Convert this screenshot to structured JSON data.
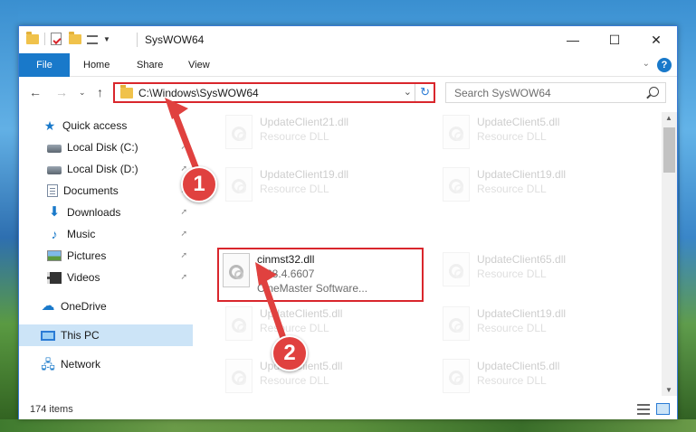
{
  "window": {
    "title": "SysWOW64",
    "controls": {
      "minimize": "—",
      "maximize": "☐",
      "close": "✕"
    }
  },
  "ribbon": {
    "tabs": [
      "File",
      "Home",
      "Share",
      "View"
    ],
    "expand_glyph": "⌄",
    "help_glyph": "?"
  },
  "nav": {
    "back_glyph": "←",
    "forward_glyph": "→",
    "recent_glyph": "⌄",
    "up_glyph": "↑",
    "address": "C:\\Windows\\SysWOW64",
    "address_dropdown_glyph": "⌄",
    "refresh_glyph": "↻",
    "search_placeholder": "Search SysWOW64"
  },
  "sidebar": {
    "items": [
      {
        "label": "Quick access",
        "icon": "star-icon",
        "pinned": false
      },
      {
        "label": "Local Disk (C:)",
        "icon": "disk-icon",
        "pinned": true
      },
      {
        "label": "Local Disk (D:)",
        "icon": "disk-icon",
        "pinned": true
      },
      {
        "label": "Documents",
        "icon": "document-icon",
        "pinned": true
      },
      {
        "label": "Downloads",
        "icon": "download-icon",
        "pinned": true
      },
      {
        "label": "Music",
        "icon": "music-icon",
        "pinned": true
      },
      {
        "label": "Pictures",
        "icon": "pictures-icon",
        "pinned": true
      },
      {
        "label": "Videos",
        "icon": "videos-icon",
        "pinned": true
      },
      {
        "label": "OneDrive",
        "icon": "cloud-icon",
        "pinned": false
      },
      {
        "label": "This PC",
        "icon": "computer-icon",
        "pinned": false,
        "selected": true
      },
      {
        "label": "Network",
        "icon": "network-icon",
        "pinned": false
      }
    ],
    "pin_glyph": "📌"
  },
  "files": [
    {
      "name": "UpdateClient21.dll",
      "desc": "Resource DLL",
      "faded": true
    },
    {
      "name": "UpdateClient5.dll",
      "desc": "Resource DLL",
      "faded": true
    },
    {
      "name": "UpdateClient19.dll",
      "desc": "Resource DLL",
      "faded": true
    },
    {
      "name": "UpdateClient19.dll",
      "desc": "Resource DLL",
      "faded": true
    },
    {
      "name": "cinmst32.dll",
      "desc": "4.38.4.6607",
      "desc2": "CineMaster Software...",
      "faded": false,
      "highlighted": true
    },
    {
      "name": "UpdateClient65.dll",
      "desc": "Resource DLL",
      "faded": true
    },
    {
      "name": "UpdateClient5.dll",
      "desc": "Resource DLL",
      "faded": true
    },
    {
      "name": "UpdateClient19.dll",
      "desc": "Resource DLL",
      "faded": true
    },
    {
      "name": "UpdateClient5.dll",
      "desc": "Resource DLL",
      "faded": true
    },
    {
      "name": "UpdateClient5.dll",
      "desc": "Resource DLL",
      "faded": true
    }
  ],
  "status": {
    "item_count": "174 items"
  },
  "annotations": {
    "badge_1": "1",
    "badge_2": "2",
    "color": "#e0413f"
  },
  "colors": {
    "accent": "#1979ca",
    "highlight_border": "#d9262c",
    "selected_bg": "#cce4f7"
  }
}
